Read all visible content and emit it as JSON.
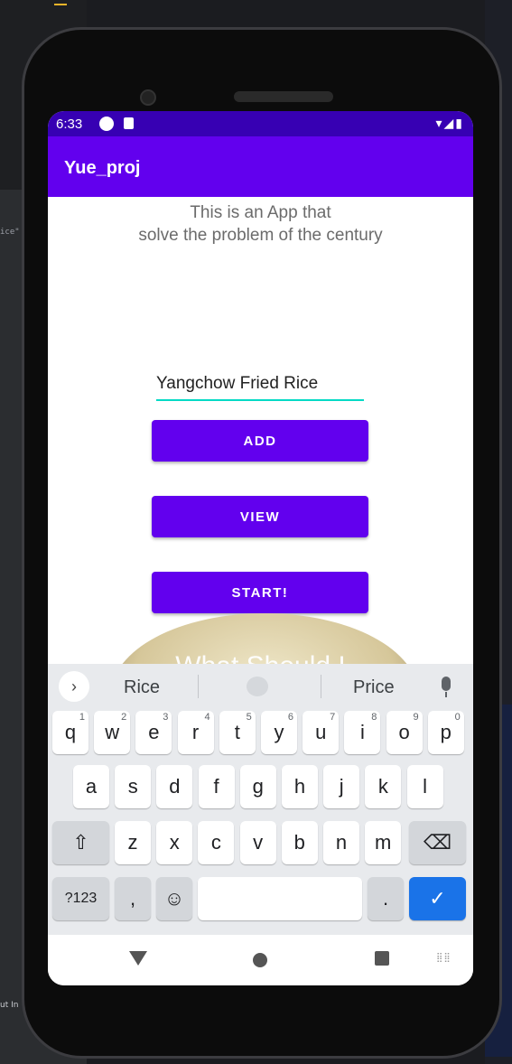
{
  "status": {
    "time": "6:33",
    "right_icons": "▾◢▮"
  },
  "appbar": {
    "title": "Yue_proj"
  },
  "main": {
    "description_line1": "This is an App that",
    "description_line2": "solve the problem of the century",
    "food_input_value": "Yangchow Fried Rice",
    "add_label": "ADD",
    "view_label": "VIEW",
    "start_label": "START!",
    "image_overlay_text": "What Should I"
  },
  "keyboard": {
    "suggestions": [
      "Rice",
      "Price"
    ],
    "row1": [
      "q",
      "w",
      "e",
      "r",
      "t",
      "y",
      "u",
      "i",
      "o",
      "p"
    ],
    "row1_hints": [
      "1",
      "2",
      "3",
      "4",
      "5",
      "6",
      "7",
      "8",
      "9",
      "0"
    ],
    "row2": [
      "a",
      "s",
      "d",
      "f",
      "g",
      "h",
      "j",
      "k",
      "l"
    ],
    "row3": [
      "z",
      "x",
      "c",
      "v",
      "b",
      "n",
      "m"
    ],
    "symbols_label": "?123",
    "comma": ",",
    "period": ".",
    "shift_icon": "⇧",
    "delete_icon": "⌫",
    "enter_icon": "✓",
    "emoji_icon": "☺",
    "suggest_arrow": "›"
  },
  "ide": {
    "code_fragment": "ice\"",
    "bottom_fragment": "ut In"
  },
  "colors": {
    "primary": "#6200ee",
    "primary_dark": "#3700b3",
    "accent": "#03dac5",
    "enter": "#1a73e8"
  }
}
